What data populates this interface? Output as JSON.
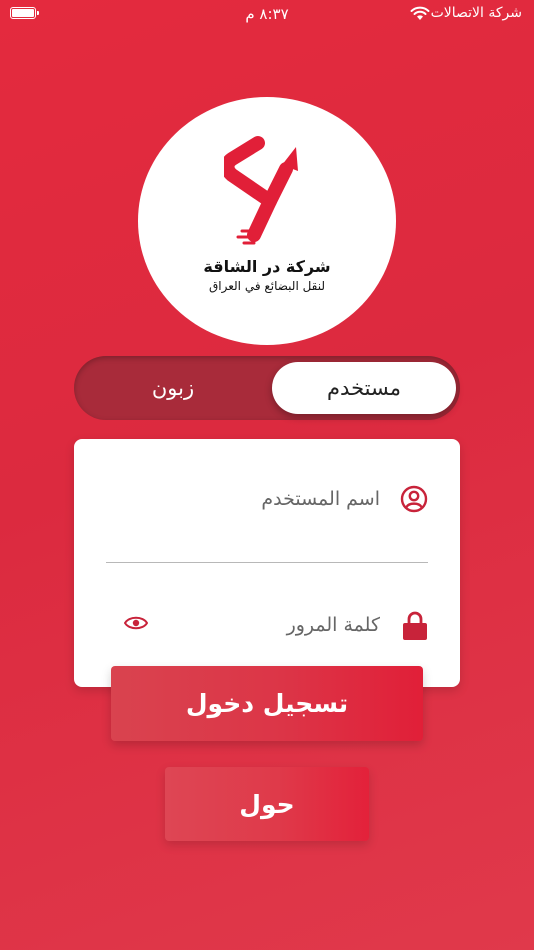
{
  "status_bar": {
    "carrier": "شركة الاتصالات",
    "time": "٨:٣٧ م"
  },
  "logo": {
    "title": "شركة در الشاقة",
    "subtitle": "لنقل البضائع في العراق"
  },
  "segment": {
    "active_label": "مستخدم",
    "inactive_label": "زبون"
  },
  "form": {
    "username_placeholder": "اسم المستخدم",
    "password_placeholder": "كلمة المرور",
    "username_value": "",
    "password_value": ""
  },
  "buttons": {
    "login_label": "تسجيل دخول",
    "about_label": "حول"
  },
  "colors": {
    "background": "#e22b3f",
    "accent": "#dc2a3f",
    "segment_track": "#a82b3a"
  },
  "icons": {
    "username": "user-circle-icon",
    "password": "lock-icon",
    "toggle_password": "eye-icon",
    "wifi": "wifi-icon",
    "battery": "battery-icon"
  }
}
